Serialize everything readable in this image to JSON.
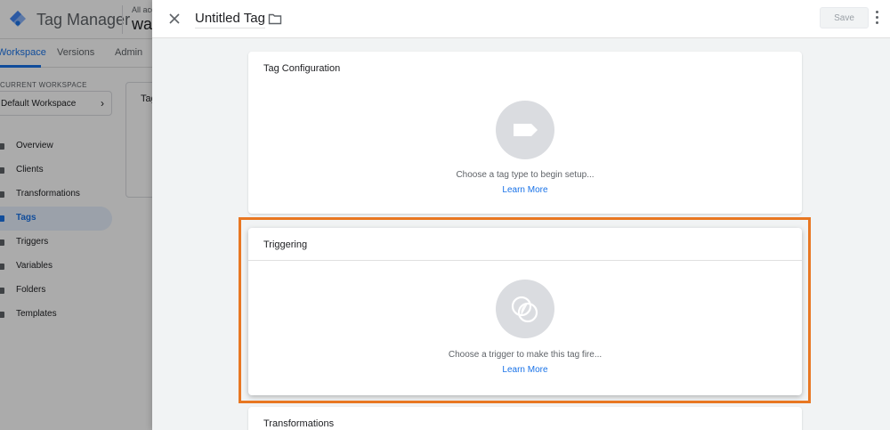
{
  "app": {
    "product_name": "Tag Manager",
    "account_label": "All acc",
    "container_name": "waz"
  },
  "tabs": [
    "Workspace",
    "Versions",
    "Admin"
  ],
  "workspace": {
    "section_label": "CURRENT WORKSPACE",
    "selected": "Default Workspace"
  },
  "nav": [
    {
      "label": "Overview"
    },
    {
      "label": "Clients"
    },
    {
      "label": "Transformations"
    },
    {
      "label": "Tags",
      "active": true
    },
    {
      "label": "Triggers"
    },
    {
      "label": "Variables"
    },
    {
      "label": "Folders"
    },
    {
      "label": "Templates"
    }
  ],
  "bg_card_title": "Tag",
  "sheet": {
    "title": "Untitled Tag",
    "save_label": "Save",
    "cards": {
      "config": {
        "title": "Tag Configuration",
        "placeholder": "Choose a tag type to begin setup...",
        "link": "Learn More"
      },
      "trigger": {
        "title": "Triggering",
        "placeholder": "Choose a trigger to make this tag fire...",
        "link": "Learn More"
      },
      "transform": {
        "title": "Transformations"
      }
    }
  },
  "colors": {
    "accent": "#1a73e8",
    "highlight": "#e87722",
    "icon_placeholder": "#dadce0"
  }
}
